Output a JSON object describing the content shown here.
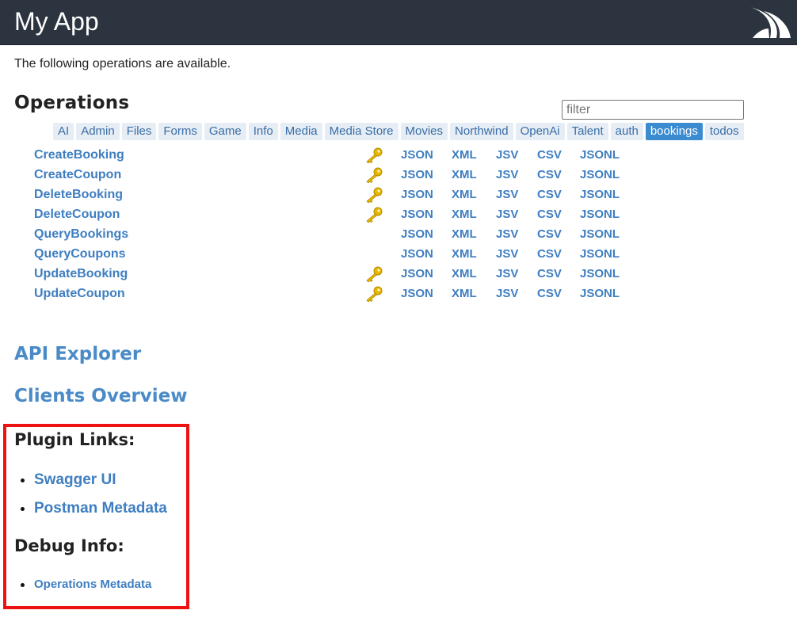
{
  "header": {
    "title": "My App",
    "logo_icon": "servicestack-logo-icon"
  },
  "intro": "The following operations are available.",
  "operations_heading": "Operations",
  "filter": {
    "placeholder": "filter",
    "value": ""
  },
  "tags": [
    {
      "label": "AI",
      "active": false
    },
    {
      "label": "Admin",
      "active": false
    },
    {
      "label": "Files",
      "active": false
    },
    {
      "label": "Forms",
      "active": false
    },
    {
      "label": "Game",
      "active": false
    },
    {
      "label": "Info",
      "active": false
    },
    {
      "label": "Media",
      "active": false
    },
    {
      "label": "Media Store",
      "active": false
    },
    {
      "label": "Movies",
      "active": false
    },
    {
      "label": "Northwind",
      "active": false
    },
    {
      "label": "OpenAi",
      "active": false
    },
    {
      "label": "Talent",
      "active": false
    },
    {
      "label": "auth",
      "active": false
    },
    {
      "label": "bookings",
      "active": true
    },
    {
      "label": "todos",
      "active": false
    }
  ],
  "formats": [
    "JSON",
    "XML",
    "JSV",
    "CSV",
    "JSONL"
  ],
  "operations": [
    {
      "name": "CreateBooking",
      "requires_auth": true
    },
    {
      "name": "CreateCoupon",
      "requires_auth": true
    },
    {
      "name": "DeleteBooking",
      "requires_auth": true
    },
    {
      "name": "DeleteCoupon",
      "requires_auth": true
    },
    {
      "name": "QueryBookings",
      "requires_auth": false
    },
    {
      "name": "QueryCoupons",
      "requires_auth": false
    },
    {
      "name": "UpdateBooking",
      "requires_auth": true
    },
    {
      "name": "UpdateCoupon",
      "requires_auth": true
    }
  ],
  "links": {
    "api_explorer": "API Explorer",
    "clients_overview": "Clients Overview"
  },
  "plugin_links": {
    "heading": "Plugin Links:",
    "items": [
      "Swagger UI",
      "Postman Metadata"
    ]
  },
  "debug_info": {
    "heading": "Debug Info:",
    "items": [
      "Operations Metadata"
    ]
  },
  "colors": {
    "header_bg": "#2c3440",
    "link": "#3e7ec1",
    "active_tag": "#3a8bd0",
    "highlight_border": "#ee1111",
    "key": "#e8b800"
  }
}
